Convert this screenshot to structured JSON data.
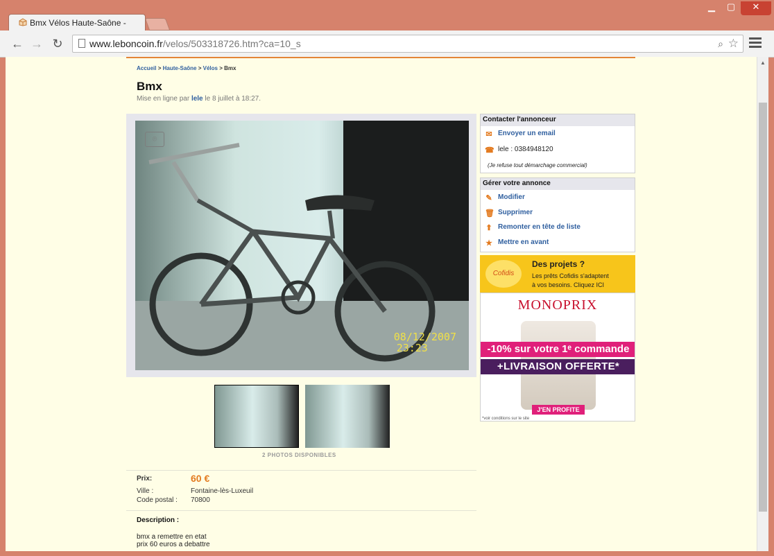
{
  "browser": {
    "tab_title": "Bmx Vélos Haute-Saône -",
    "url_domain": "www.leboncoin.fr",
    "url_path": "/velos/503318726.htm?ca=10_s"
  },
  "breadcrumb": {
    "home": "Accueil",
    "region": "Haute-Saône",
    "category": "Vélos",
    "current": "Bmx",
    "sep": " > "
  },
  "ad": {
    "title": "Bmx",
    "posted_prefix": "Mise en ligne par",
    "user": "lele",
    "posted_suffix": "le 8 juillet à 18:27.",
    "photo_date": "08/12/2007",
    "photo_time": "23:23",
    "photos_count": "2 PHOTOS DISPONIBLES",
    "price_label": "Prix:",
    "price": "60 €",
    "city_label": "Ville :",
    "city": "Fontaine-lès-Luxeuil",
    "postal_label": "Code postal :",
    "postal": "70800",
    "description_title": "Description :",
    "description": "bmx a remettre en etat\nprix 60 euros a debattre"
  },
  "contact": {
    "title": "Contacter l'annonceur",
    "email": "Envoyer un email",
    "name": "lele :",
    "phone": "0384948120",
    "note": "(Je refuse tout démarchage commercial)"
  },
  "manage": {
    "title": "Gérer votre annonce",
    "items": [
      "Modifier",
      "Supprimer",
      "Remonter en tête de liste",
      "Mettre en avant"
    ]
  },
  "cofidis": {
    "logo": "Cofidis",
    "heading": "Des projets ?",
    "line1": "Les prêts Cofidis s'adaptent",
    "line2": "à vos besoins. Cliquez ICI"
  },
  "monoprix": {
    "brand": "MONOPRIX",
    "offer1": "-10% sur votre 1ᵉ commande",
    "offer2": "+LIVRAISON OFFERTE*",
    "cta": "J'EN PROFITE",
    "fine": "*voir conditions sur le site"
  }
}
